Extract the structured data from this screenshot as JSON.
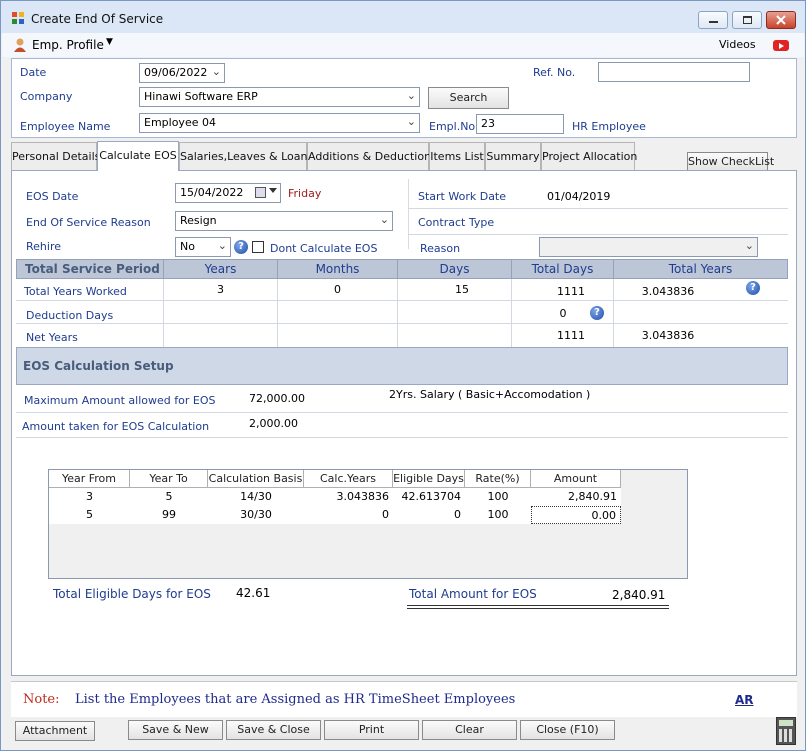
{
  "window": {
    "title": "Create End Of Service"
  },
  "menu": {
    "emp_profile": "Emp. Profile",
    "videos": "Videos"
  },
  "header": {
    "date_label": "Date",
    "date_value": "09/06/2022",
    "ref_label": "Ref. No.",
    "ref_value": "",
    "company_label": "Company",
    "company_value": "Hinawi Software ERP",
    "search_label": "Search",
    "employee_label": "Employee Name",
    "employee_value": "Employee 04",
    "emplno_label": "Empl.No",
    "emplno_value": "23",
    "hr_label": "HR Employee"
  },
  "tabs": [
    {
      "label": "Personal Details"
    },
    {
      "label": "Calculate EOS"
    },
    {
      "label": "Salaries,Leaves & Loans"
    },
    {
      "label": "Additions & Deductions"
    },
    {
      "label": "Items List"
    },
    {
      "label": "Summary"
    },
    {
      "label": "Project Allocation"
    }
  ],
  "show_checklist": "Show CheckList",
  "eos": {
    "date_label": "EOS Date",
    "date_value": "15/04/2022",
    "day": "Friday",
    "start_label": "Start Work Date",
    "start_value": "01/04/2019",
    "reason_label": "End Of Service Reason",
    "reason_value": "Resign",
    "contract_label": "Contract Type",
    "rehire_label": "Rehire",
    "rehire_value": "No",
    "dont_calc": "Dont Calculate EOS",
    "reason2_label": "Reason"
  },
  "service": {
    "headers": [
      "Total Service Period",
      "Years",
      "Months",
      "Days",
      "Total Days",
      "Total Years"
    ],
    "rows": [
      {
        "label": "Total Years Worked",
        "years": "3",
        "months": "0",
        "days": "15",
        "total_days": "1111",
        "total_years": "3.043836"
      },
      {
        "label": "Deduction Days",
        "years": "",
        "months": "",
        "days": "",
        "total_days": "0",
        "total_years": ""
      },
      {
        "label": "Net Years",
        "years": "",
        "months": "",
        "days": "",
        "total_days": "1111",
        "total_years": "3.043836"
      }
    ]
  },
  "setup": {
    "title": "EOS Calculation Setup",
    "max_label": "Maximum Amount allowed for EOS",
    "max_value": "72,000.00",
    "formula": "2Yrs. Salary ( Basic+Accomodation )",
    "taken_label": "Amount taken for EOS Calculation",
    "taken_value": "2,000.00"
  },
  "calc_table": {
    "headers": [
      "Year From",
      "Year To",
      "Calculation Basis",
      "Calc.Years",
      "Eligible Days",
      "Rate(%)",
      "Amount"
    ],
    "rows": [
      [
        "3",
        "5",
        "14/30",
        "3.043836",
        "42.613704",
        "100",
        "2,840.91"
      ],
      [
        "5",
        "99",
        "30/30",
        "0",
        "0",
        "100",
        "0.00"
      ]
    ]
  },
  "totals": {
    "days_label": "Total Eligible Days for EOS",
    "days_value": "42.61",
    "amount_label": "Total Amount for EOS",
    "amount_value": "2,840.91"
  },
  "note": {
    "label": "Note:",
    "text": "List the Employees that are Assigned as HR  TimeSheet Employees",
    "ar": "AR"
  },
  "buttons": {
    "attachment": "Attachment",
    "save_new": "Save & New",
    "save_close": "Save & Close",
    "print": "Print",
    "clear": "Clear",
    "close": "Close (F10)"
  }
}
